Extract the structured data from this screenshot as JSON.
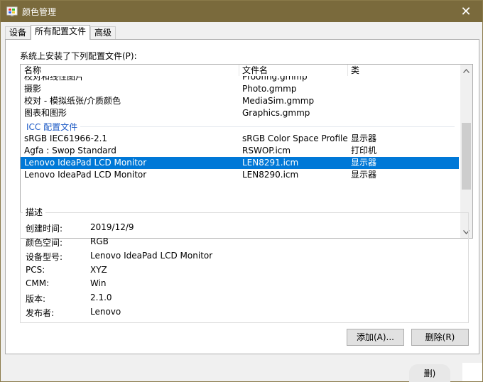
{
  "window": {
    "title": "颜色管理",
    "close_symbol": "✕"
  },
  "tabs": [
    {
      "label": "设备",
      "active": false
    },
    {
      "label": "所有配置文件",
      "active": true
    },
    {
      "label": "高级",
      "active": false
    }
  ],
  "profiles_panel": {
    "label": "系统上安装了下列配置文件(P):",
    "columns": [
      "名称",
      "文件名",
      "类"
    ],
    "rows": [
      {
        "name": "校对和线性图片",
        "file": "Proofing.gmmp",
        "type": ""
      },
      {
        "name": "摄影",
        "file": "Photo.gmmp",
        "type": ""
      },
      {
        "name": "校对 - 模拟纸张/介质颜色",
        "file": "MediaSim.gmmp",
        "type": ""
      },
      {
        "name": "图表和图形",
        "file": "Graphics.gmmp",
        "type": ""
      }
    ],
    "group_label": "ICC 配置文件",
    "icc_rows": [
      {
        "name": "sRGB IEC61966-2.1",
        "file": "sRGB Color Space Profile.ic...",
        "type": "显示器"
      },
      {
        "name": "Agfa : Swop Standard",
        "file": "RSWOP.icm",
        "type": "打印机"
      },
      {
        "name": "Lenovo IdeaPad LCD Monitor",
        "file": "LEN8291.icm",
        "type": "显示器"
      },
      {
        "name": "Lenovo IdeaPad LCD Monitor",
        "file": "LEN8290.icm",
        "type": "显示器"
      }
    ],
    "selected_index": 2
  },
  "description": {
    "title": "描述",
    "fields": [
      {
        "label": "创建时间:",
        "value": "2019/12/9"
      },
      {
        "label": "颜色空间:",
        "value": "RGB"
      },
      {
        "label": "设备型号:",
        "value": "Lenovo IdeaPad LCD Monitor"
      },
      {
        "label": "PCS:",
        "value": "XYZ"
      },
      {
        "label": "CMM:",
        "value": "Win"
      },
      {
        "label": "版本:",
        "value": "2.1.0"
      },
      {
        "label": "发布者:",
        "value": "Lenovo"
      }
    ]
  },
  "buttons": {
    "add": "添加(A)...",
    "remove": "删除(R)"
  },
  "overlay": {
    "partial_label": "删)"
  },
  "colors": {
    "titlebar": "#7a6a3c",
    "selection": "#0078d7",
    "group_header": "#1e5bc6"
  },
  "icons": {
    "app": "color-management-icon",
    "close": "close-icon",
    "scroll_up": "chevron-up-icon",
    "scroll_down": "chevron-down-icon"
  }
}
